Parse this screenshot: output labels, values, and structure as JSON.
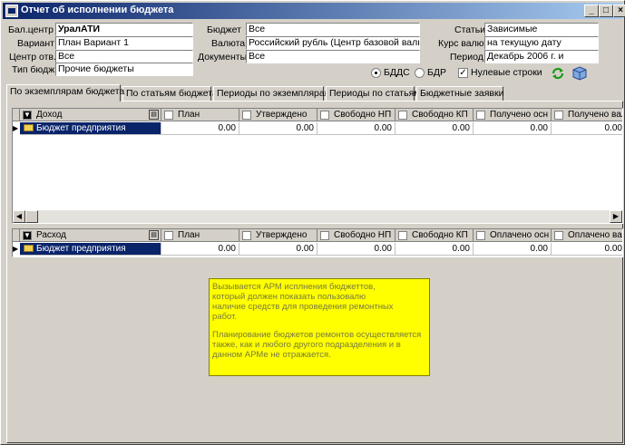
{
  "window": {
    "title": "Отчет об исполнении бюджета",
    "controls": {
      "minimize": "_",
      "maximize": "□",
      "close": "×"
    }
  },
  "filters": {
    "balcenter": {
      "label": "Бал.центр",
      "value": "УралАТИ"
    },
    "variant": {
      "label": "Вариант",
      "value": "План Вариант 1"
    },
    "resp_center": {
      "label": "Центр отв.",
      "value": "Все"
    },
    "budget_type": {
      "label": "Тип бюдж.",
      "value": "Прочие бюджеты"
    },
    "budget": {
      "label": "Бюджет",
      "value": "Все"
    },
    "currency": {
      "label": "Валюта",
      "value": "Российский рубль (Центр базовой валюты)"
    },
    "documents": {
      "label": "Документы",
      "value": "Все"
    },
    "articles": {
      "label": "Статьи",
      "value": "Зависимые"
    },
    "rate": {
      "label": "Курс валют",
      "value": "на текущую дату"
    },
    "period": {
      "label": "Период",
      "value": "Декабрь  2006 г. и"
    }
  },
  "options": {
    "bdds": {
      "label": "БДДС",
      "selected": true
    },
    "bdr": {
      "label": "БДР",
      "selected": false
    },
    "zero_rows": {
      "label": "Нулевые строки",
      "checked": true
    }
  },
  "toolbar": {
    "refresh_icon": "refresh-icon",
    "cube_icon": "cube-icon"
  },
  "tabs": [
    {
      "label": "По экземплярам бюджета",
      "active": true
    },
    {
      "label": "По статьям бюджета",
      "active": false
    },
    {
      "label": "Периоды по экземплярам",
      "active": false
    },
    {
      "label": "Периоды по статьям",
      "active": false
    },
    {
      "label": "Бюджетные заявки",
      "active": false
    }
  ],
  "income_grid": {
    "first_col": "Доход",
    "columns": [
      "План",
      "Утверждено",
      "Свободно НП",
      "Свободно КП",
      "Получено осн",
      "Получено вал"
    ],
    "rows": [
      {
        "name": "Бюджет предприятия",
        "values": [
          "0.00",
          "0.00",
          "0.00",
          "0.00",
          "0.00",
          "0.00"
        ]
      }
    ]
  },
  "expense_grid": {
    "first_col": "Расход",
    "columns": [
      "План",
      "Утверждено",
      "Свободно НП",
      "Свободно КП",
      "Оплачено осн",
      "Оплачено вал"
    ],
    "rows": [
      {
        "name": "Бюджет предприятия",
        "values": [
          "0.00",
          "0.00",
          "0.00",
          "0.00",
          "0.00",
          "0.00"
        ]
      }
    ]
  },
  "note": {
    "p1": "Вызывается АРМ исплнения бюджеттов,\nкоторый должен показать пользовалю\nналичие средств для проведения ремонтных\nработ.",
    "p2": "Планирование бюджетов ремонтов осуществляется\nтакже, как и любого другого подразделения и в\nданном АРМе не отражается."
  },
  "colors": {
    "title_start": "#0a246a",
    "title_end": "#a6caf0",
    "selection": "#0a246a",
    "note_bg": "#ffff00"
  }
}
